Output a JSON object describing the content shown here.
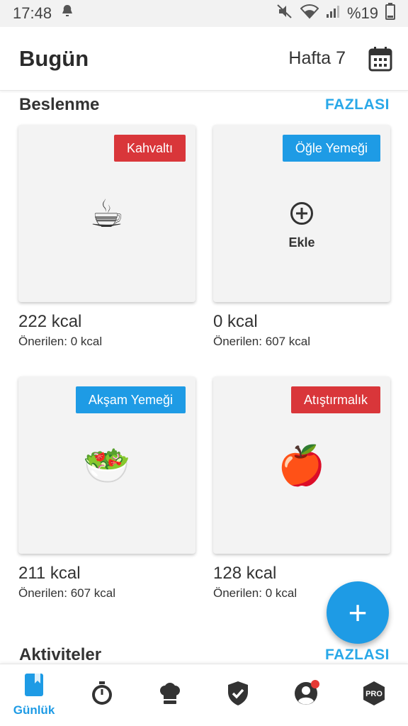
{
  "status_bar": {
    "time": "17:48",
    "battery": "%19"
  },
  "header": {
    "title": "Bugün",
    "week": "Hafta 7"
  },
  "nutrition": {
    "title": "Beslenme",
    "more": "FAZLASI",
    "meals": [
      {
        "badge": "Kahvaltı",
        "badge_color": "#d9363a",
        "emoji": "☕",
        "kcal": "222 kcal",
        "recommended": "Önerilen: 0 kcal"
      },
      {
        "badge": "Öğle Yemeği",
        "badge_color": "#1e9be5",
        "add_label": "Ekle",
        "kcal": "0 kcal",
        "recommended": "Önerilen: 607 kcal"
      },
      {
        "badge": "Akşam Yemeği",
        "badge_color": "#1e9be5",
        "emoji": "🥗",
        "kcal": "211 kcal",
        "recommended": "Önerilen: 607 kcal"
      },
      {
        "badge": "Atıştırmalık",
        "badge_color": "#d9363a",
        "emoji": "🍎",
        "kcal": "128 kcal",
        "recommended": "Önerilen: 0 kcal"
      }
    ]
  },
  "activities": {
    "title": "Aktiviteler",
    "more": "FAZLASI"
  },
  "fab": {
    "icon": "+"
  },
  "bottom_nav": {
    "items": [
      {
        "icon": "diary-icon",
        "label": "Günlük",
        "active": true
      },
      {
        "icon": "stopwatch-icon"
      },
      {
        "icon": "chef-hat-icon"
      },
      {
        "icon": "shield-check-icon"
      },
      {
        "icon": "profile-icon",
        "notification": true
      },
      {
        "icon": "pro-badge-icon",
        "text": "PRO"
      }
    ]
  },
  "colors": {
    "accent": "#1e9be5",
    "link": "#29a8e8",
    "red": "#d9363a"
  }
}
